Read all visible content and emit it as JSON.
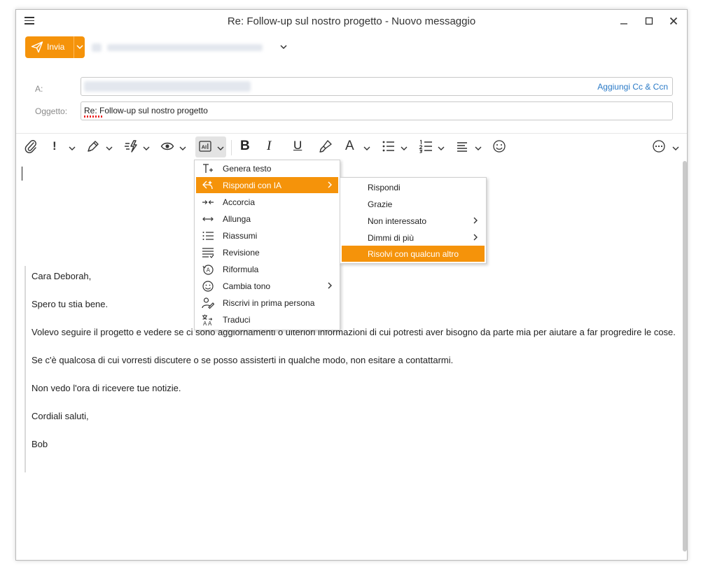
{
  "window": {
    "title": "Re: Follow-up sul nostro progetto - Nuovo messaggio",
    "minimize_label": "—",
    "maximize_label": "☐",
    "close_label": "✕"
  },
  "compose": {
    "send_label": "Invia",
    "to_label": "A:",
    "subject_label": "Oggetto:",
    "subject_value": "Re: Follow-up sul nostro progetto",
    "add_cc_label": "Aggiungi Cc & Ccn"
  },
  "toolbar": {
    "icons": [
      "paperclip-icon",
      "priority-icon",
      "pen-icon",
      "lightning-icon",
      "eye-icon",
      "ai-icon",
      "bold-icon",
      "italic-icon",
      "underline-icon",
      "brush-icon",
      "font-icon",
      "bullets-icon",
      "numbered-list-icon",
      "align-icon",
      "emoji-icon",
      "more-icon"
    ],
    "bold_label": "B",
    "italic_label": "I",
    "underline_label": "U",
    "font_label": "A",
    "priority_label": "!"
  },
  "ai_menu": {
    "items": [
      {
        "label": "Genera testo",
        "icon": "generate-text-icon"
      },
      {
        "label": "Rispondi con IA",
        "icon": "reply-ai-icon",
        "highlighted": true,
        "submenu": true
      },
      {
        "label": "Accorcia",
        "icon": "shorten-icon"
      },
      {
        "label": "Allunga",
        "icon": "lengthen-icon"
      },
      {
        "label": "Riassumi",
        "icon": "summarize-icon"
      },
      {
        "label": "Revisione",
        "icon": "review-icon"
      },
      {
        "label": "Riformula",
        "icon": "rephrase-icon"
      },
      {
        "label": "Cambia tono",
        "icon": "tone-icon",
        "submenu": true
      },
      {
        "label": "Riscrivi in prima persona",
        "icon": "first-person-icon"
      },
      {
        "label": "Traduci",
        "icon": "translate-icon"
      }
    ]
  },
  "reply_submenu": {
    "items": [
      {
        "label": "Rispondi"
      },
      {
        "label": "Grazie"
      },
      {
        "label": "Non interessato",
        "submenu": true
      },
      {
        "label": "Dimmi di più",
        "submenu": true
      },
      {
        "label": "Risolvi con qualcun altro",
        "highlighted": true
      }
    ]
  },
  "body": {
    "paragraphs": [
      "Cara Deborah,",
      "Spero tu stia bene.",
      "Volevo seguire il progetto e vedere se ci sono aggiornamenti o ulteriori informazioni di cui potresti aver bisogno da parte mia per aiutare a far progredire le cose.",
      "Se c'è qualcosa di cui vorresti discutere o se posso assisterti in qualche modo, non esitare a contattarmi.",
      "Non vedo l'ora di ricevere tue notizie.",
      "Cordiali saluti,",
      "Bob"
    ]
  },
  "colors": {
    "accent": "#f5930a",
    "link": "#2a7ac7"
  }
}
